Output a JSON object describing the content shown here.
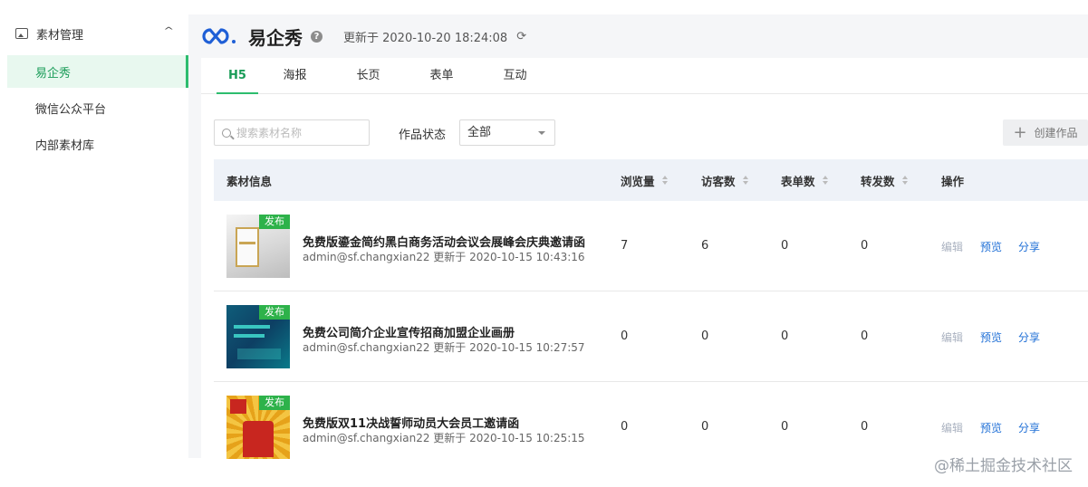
{
  "sidebar": {
    "group_label": "素材管理",
    "items": [
      {
        "label": "易企秀",
        "active": true
      },
      {
        "label": "微信公众平台",
        "active": false
      },
      {
        "label": "内部素材库",
        "active": false
      }
    ]
  },
  "header": {
    "brand": "易企秀",
    "help": "?",
    "updated": "更新于 2020-10-20 18:24:08"
  },
  "tabs": [
    {
      "label": "H5",
      "active": true
    },
    {
      "label": "海报",
      "active": false
    },
    {
      "label": "长页",
      "active": false
    },
    {
      "label": "表单",
      "active": false
    },
    {
      "label": "互动",
      "active": false
    }
  ],
  "toolbar": {
    "search_placeholder": "搜索素材名称",
    "status_label": "作品状态",
    "status_value": "全部",
    "create_label": "创建作品"
  },
  "table": {
    "headers": {
      "info": "素材信息",
      "views": "浏览量",
      "visitors": "访客数",
      "forms": "表单数",
      "shares": "转发数",
      "actions": "操作"
    },
    "rows": [
      {
        "badge": "发布",
        "title": "免费版鎏金简约黑白商务活动会议会展峰会庆典邀请函",
        "meta": "admin@sf.changxian22 更新于 2020-10-15 10:43:16",
        "views": "7",
        "visitors": "6",
        "forms": "0",
        "shares": "0",
        "edit": "编辑",
        "preview": "预览",
        "share": "分享"
      },
      {
        "badge": "发布",
        "title": "免费公司简介企业宣传招商加盟企业画册",
        "meta": "admin@sf.changxian22 更新于 2020-10-15 10:27:57",
        "views": "0",
        "visitors": "0",
        "forms": "0",
        "shares": "0",
        "edit": "编辑",
        "preview": "预览",
        "share": "分享"
      },
      {
        "badge": "发布",
        "title": "免费版双11决战誓师动员大会员工邀请函",
        "meta": "admin@sf.changxian22 更新于 2020-10-15 10:25:15",
        "views": "0",
        "visitors": "0",
        "forms": "0",
        "shares": "0",
        "edit": "编辑",
        "preview": "预览",
        "share": "分享"
      }
    ]
  },
  "watermark": "@稀土掘金技术社区",
  "colors": {
    "accent": "#2dbd6e",
    "link": "#1f6fd6",
    "badge": "#2db24a",
    "logo": "#1f5fd6"
  }
}
